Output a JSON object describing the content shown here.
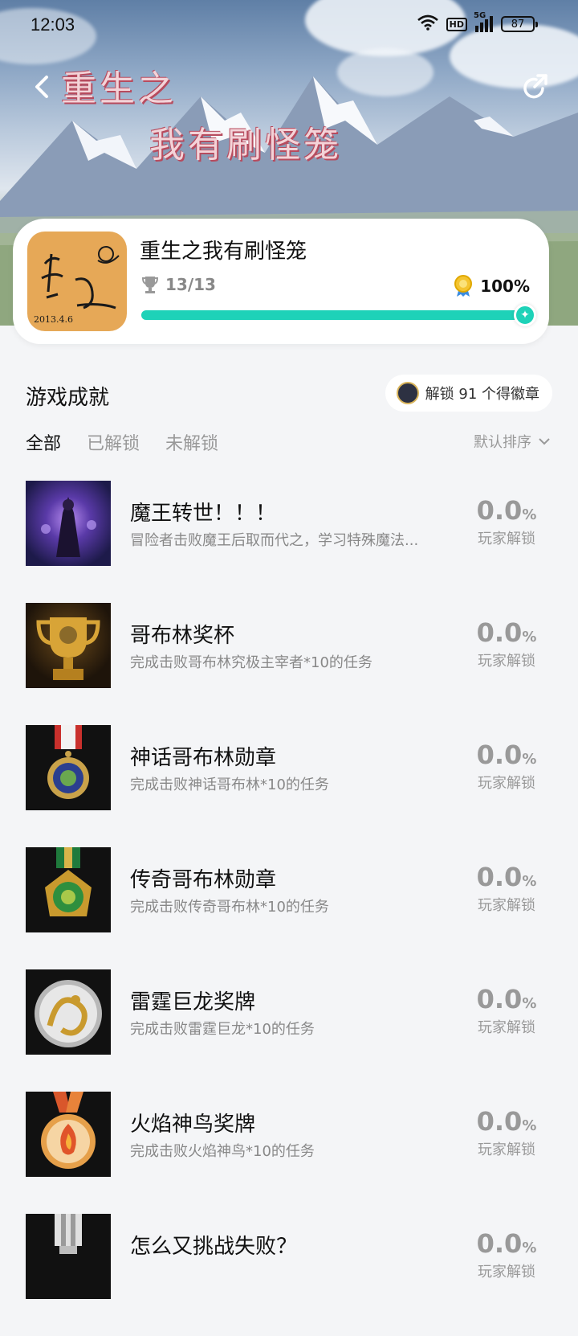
{
  "status_bar": {
    "time": "12:03",
    "network": "5G",
    "hd": "HD",
    "battery": "87"
  },
  "hero": {
    "title_line1": "重生之",
    "title_line2": "我有刷怪笼"
  },
  "game": {
    "title": "重生之我有刷怪笼",
    "trophies": "13/13",
    "percent": "100%",
    "progress": 1.0,
    "icon_text": "2013.4.6"
  },
  "section": {
    "title": "游戏成就",
    "badge_text": "解锁 91 个得徽章",
    "tabs": [
      "全部",
      "已解锁",
      "未解锁"
    ],
    "sort_label": "默认排序"
  },
  "achievements": [
    {
      "name": "魔王转世！！！",
      "desc": "冒险者击败魔王后取而代之，学习特殊魔法...",
      "rate": "0.0",
      "unit": "%",
      "label": "玩家解锁",
      "icon": "demon-king-icon"
    },
    {
      "name": "哥布林奖杯",
      "desc": "完成击败哥布林究极主宰者*10的任务",
      "rate": "0.0",
      "unit": "%",
      "label": "玩家解锁",
      "icon": "goblin-trophy-icon"
    },
    {
      "name": "神话哥布林勋章",
      "desc": "完成击败神话哥布林*10的任务",
      "rate": "0.0",
      "unit": "%",
      "label": "玩家解锁",
      "icon": "mythic-goblin-medal-icon"
    },
    {
      "name": "传奇哥布林勋章",
      "desc": "完成击败传奇哥布林*10的任务",
      "rate": "0.0",
      "unit": "%",
      "label": "玩家解锁",
      "icon": "legend-goblin-medal-icon"
    },
    {
      "name": "雷霆巨龙奖牌",
      "desc": "完成击败雷霆巨龙*10的任务",
      "rate": "0.0",
      "unit": "%",
      "label": "玩家解锁",
      "icon": "thunder-dragon-medal-icon"
    },
    {
      "name": "火焰神鸟奖牌",
      "desc": "完成击败火焰神鸟*10的任务",
      "rate": "0.0",
      "unit": "%",
      "label": "玩家解锁",
      "icon": "fire-bird-medal-icon"
    },
    {
      "name": "怎么又挑战失败？",
      "desc": "",
      "rate": "0.0",
      "unit": "%",
      "label": "玩家解锁",
      "icon": "silver-medal-icon"
    }
  ],
  "colors": {
    "accent": "#1ed2b8",
    "muted": "#999999"
  }
}
